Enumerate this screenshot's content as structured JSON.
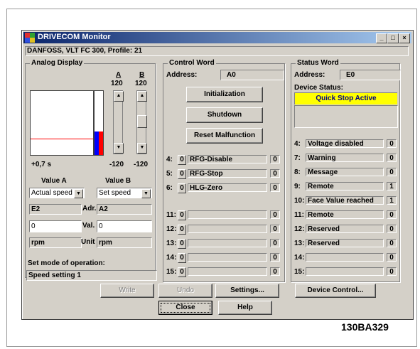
{
  "window": {
    "title": "DRIVECOM Monitor"
  },
  "device_info": "DANFOSS, VLT FC 300, Profile: 21",
  "analog": {
    "group_label": "Analog Display",
    "col_a": "A",
    "col_b": "B",
    "max_a": "120",
    "max_b": "120",
    "min_a": "-120",
    "min_b": "-120",
    "time": "+0,7 s",
    "value_a_label": "Value A",
    "value_b_label": "Value B",
    "select_a": "Actual speed",
    "select_b": "Set speed",
    "adr_a": "E2",
    "adr_label": "Adr.",
    "adr_b": "A2",
    "val_a": "0",
    "val_label": "Val.",
    "val_b": "0",
    "unit_a": "rpm",
    "unit_label": "Unit",
    "unit_b": "rpm",
    "series_a_level": 0.38,
    "series_b_level": 0.38,
    "mode_label": "Set mode of operation:",
    "mode_value": "Speed setting 1"
  },
  "control": {
    "group_label": "Control Word",
    "address_label": "Address:",
    "address": "A0",
    "buttons": [
      "Initialization",
      "Shutdown",
      "Reset Malfunction"
    ],
    "rows": [
      {
        "num": "4:",
        "bit": "0",
        "text": "RFG-Disable",
        "val": "0"
      },
      {
        "num": "5:",
        "bit": "0",
        "text": "RFG-Stop",
        "val": "0"
      },
      {
        "num": "6:",
        "bit": "0",
        "text": "HLG-Zero",
        "val": "0"
      },
      {
        "num": "11:",
        "bit": "0",
        "text": "",
        "val": "0"
      },
      {
        "num": "12:",
        "bit": "0",
        "text": "",
        "val": "0"
      },
      {
        "num": "13:",
        "bit": "0",
        "text": "",
        "val": "0"
      },
      {
        "num": "14:",
        "bit": "0",
        "text": "",
        "val": "0"
      },
      {
        "num": "15:",
        "bit": "0",
        "text": "",
        "val": "0"
      }
    ]
  },
  "status": {
    "group_label": "Status Word",
    "address_label": "Address:",
    "address": "E0",
    "device_status_label": "Device Status:",
    "device_status": "Quick Stop Active",
    "rows": [
      {
        "num": "4:",
        "text": "Voltage disabled",
        "val": "0"
      },
      {
        "num": "7:",
        "text": "Warning",
        "val": "0"
      },
      {
        "num": "8:",
        "text": "Message",
        "val": "0"
      },
      {
        "num": "9:",
        "text": "Remote",
        "val": "1"
      },
      {
        "num": "10:",
        "text": "Face Value reached",
        "val": "1"
      },
      {
        "num": "11:",
        "text": "Remote",
        "val": "0"
      },
      {
        "num": "12:",
        "text": "Reserved",
        "val": "0"
      },
      {
        "num": "13:",
        "text": "Reserved",
        "val": "0"
      },
      {
        "num": "14:",
        "text": "",
        "val": "0"
      },
      {
        "num": "15:",
        "text": "",
        "val": "0"
      }
    ]
  },
  "bottom_buttons": {
    "write": "Write",
    "undo": "Undo",
    "settings": "Settings...",
    "device_control": "Device Control...",
    "close": "Close",
    "help": "Help"
  },
  "figure_code": "130BA329",
  "colors": {
    "status_bg": "#ffff00",
    "series_a": "#0000ff",
    "series_b": "#ff0000",
    "line": "#ff0000"
  }
}
